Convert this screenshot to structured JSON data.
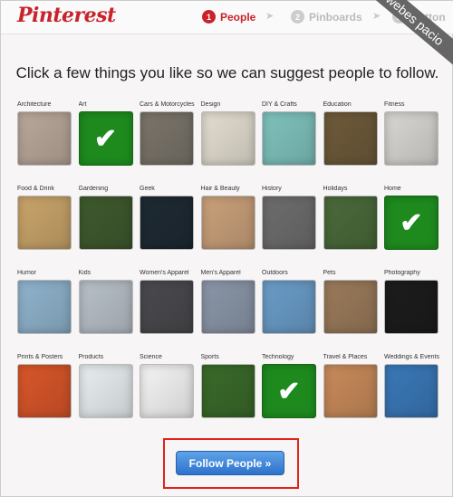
{
  "header": {
    "logo": "Pinterest",
    "steps": [
      {
        "num": "1",
        "label": "People"
      },
      {
        "num": "2",
        "label": "Pinboards"
      },
      {
        "num": "3",
        "label": "Button"
      }
    ],
    "watermark": "webes pacio"
  },
  "headline": "Click a few things you like so we can suggest people to follow.",
  "categories": [
    {
      "label": "Architecture",
      "selected": false,
      "color": "#b9a79a"
    },
    {
      "label": "Art",
      "selected": true,
      "color": "#1e8a1e"
    },
    {
      "label": "Cars & Motorcycles",
      "selected": false,
      "color": "#7a746a"
    },
    {
      "label": "Design",
      "selected": false,
      "color": "#e3ddd0"
    },
    {
      "label": "DIY & Crafts",
      "selected": false,
      "color": "#7fc2bd"
    },
    {
      "label": "Education",
      "selected": false,
      "color": "#6e5a3a"
    },
    {
      "label": "Fitness",
      "selected": false,
      "color": "#d8d6d2"
    },
    {
      "label": "Food & Drink",
      "selected": false,
      "color": "#c9a46a"
    },
    {
      "label": "Gardening",
      "selected": false,
      "color": "#3f5a2e"
    },
    {
      "label": "Geek",
      "selected": false,
      "color": "#1e2a33"
    },
    {
      "label": "Hair & Beauty",
      "selected": false,
      "color": "#c9a07a"
    },
    {
      "label": "History",
      "selected": false,
      "color": "#6d6d6d"
    },
    {
      "label": "Holidays",
      "selected": false,
      "color": "#4a6a3a"
    },
    {
      "label": "Home",
      "selected": true,
      "color": "#1e8a1e"
    },
    {
      "label": "Humor",
      "selected": false,
      "color": "#8fb3cc"
    },
    {
      "label": "Kids",
      "selected": false,
      "color": "#b8c0c8"
    },
    {
      "label": "Women's Apparel",
      "selected": false,
      "color": "#4a4a4e"
    },
    {
      "label": "Men's Apparel",
      "selected": false,
      "color": "#8a96a8"
    },
    {
      "label": "Outdoors",
      "selected": false,
      "color": "#6a9cc8"
    },
    {
      "label": "Pets",
      "selected": false,
      "color": "#9a7a5a"
    },
    {
      "label": "Photography",
      "selected": false,
      "color": "#1c1c1c"
    },
    {
      "label": "Prints & Posters",
      "selected": false,
      "color": "#d8562a"
    },
    {
      "label": "Products",
      "selected": false,
      "color": "#e8eef0"
    },
    {
      "label": "Science",
      "selected": false,
      "color": "#f4f4f4"
    },
    {
      "label": "Sports",
      "selected": false,
      "color": "#3a6a2a"
    },
    {
      "label": "Technology",
      "selected": true,
      "color": "#1e8a1e"
    },
    {
      "label": "Travel & Places",
      "selected": false,
      "color": "#c88a5a"
    },
    {
      "label": "Weddings & Events",
      "selected": false,
      "color": "#3a78b8"
    }
  ],
  "check_glyph": "✔",
  "follow_button": "Follow People »"
}
